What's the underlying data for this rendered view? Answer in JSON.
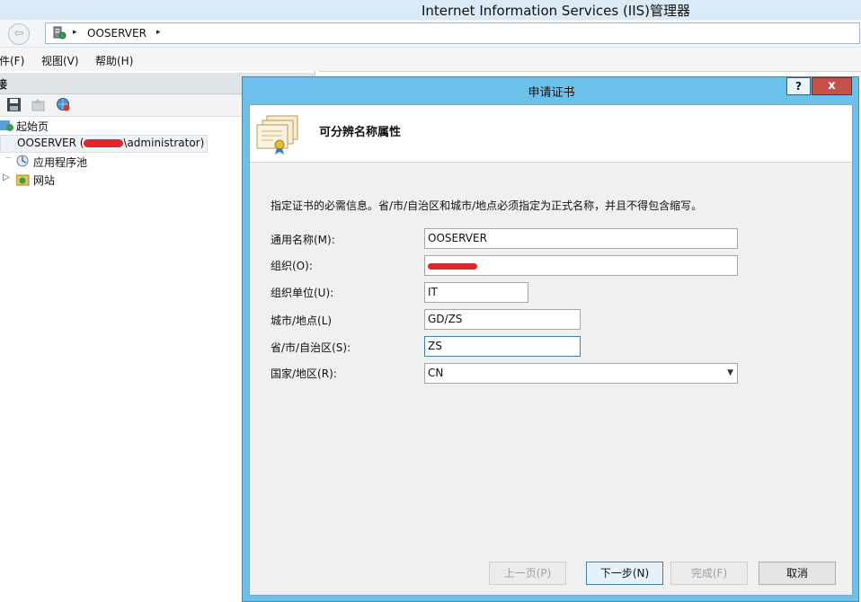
{
  "window": {
    "title": "Internet Information Services (IIS)管理器"
  },
  "address_bar": {
    "back_icon": "back-arrow-icon",
    "server_icon": "server-icon",
    "breadcrumb": "OOSERVER",
    "separator": "▸"
  },
  "menu": {
    "items": [
      "件(F)",
      "视图(V)",
      "帮助(H)"
    ]
  },
  "connections": {
    "header": "接",
    "toolbar_icons": [
      "save-icon",
      "up-icon",
      "connect-icon"
    ],
    "tree": [
      {
        "label": "起始页",
        "icon": "start-page-icon"
      },
      {
        "label_prefix": "OOSERVER (",
        "label_suffix": "\\administrator)",
        "icon": "server-icon",
        "selected": true
      },
      {
        "label": "应用程序池",
        "icon": "app-pool-icon"
      },
      {
        "label": "网站",
        "icon": "sites-icon",
        "expander": "▷"
      }
    ]
  },
  "dialog": {
    "title": "申请证书",
    "help_label": "?",
    "close_label": "x",
    "header_title": "可分辨名称属性",
    "instruction": "指定证书的必需信息。省/市/自治区和城市/地点必须指定为正式名称，并且不得包含缩写。",
    "fields": [
      {
        "label": "通用名称(M):",
        "value": "OOSERVER"
      },
      {
        "label": "组织(O):",
        "value": ""
      },
      {
        "label": "组织单位(U):",
        "value": "IT"
      },
      {
        "label": "城市/地点(L)",
        "value": "GD/ZS"
      },
      {
        "label": "省/市/自治区(S):",
        "value": "ZS"
      },
      {
        "label": "国家/地区(R):",
        "value": "CN",
        "type": "select"
      }
    ],
    "buttons": {
      "prev": "上一页(P)",
      "next": "下一步(N)",
      "finish": "完成(F)",
      "cancel": "取消"
    }
  },
  "colors": {
    "dialog_frame": "#6cc1ea",
    "close_button": "#c7504a",
    "titlebar": "#daeaf7"
  }
}
